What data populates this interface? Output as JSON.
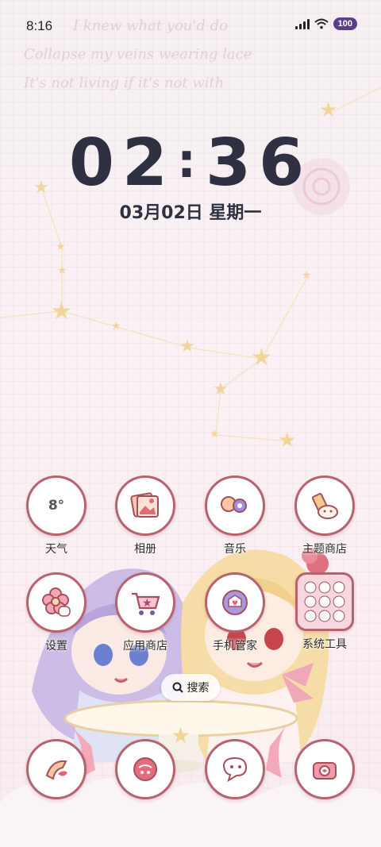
{
  "status_bar": {
    "time": "8:16",
    "battery": "100"
  },
  "background_text": {
    "line1": "I knew what you'd do",
    "line2": "Collapse my veins wearing lace",
    "line3": "It's not living if it's not with"
  },
  "lock_clock": {
    "hours": "02",
    "minutes": "36",
    "date": "03月02日 星期一"
  },
  "apps": [
    {
      "label": "天气",
      "icon": "weather-icon",
      "glyph": "8°"
    },
    {
      "label": "相册",
      "icon": "gallery-icon",
      "glyph": ""
    },
    {
      "label": "音乐",
      "icon": "music-icon",
      "glyph": ""
    },
    {
      "label": "主题商店",
      "icon": "theme-store-icon",
      "glyph": ""
    },
    {
      "label": "设置",
      "icon": "settings-icon",
      "glyph": ""
    },
    {
      "label": "应用商店",
      "icon": "app-store-icon",
      "glyph": ""
    },
    {
      "label": "手机管家",
      "icon": "phone-manager-icon",
      "glyph": ""
    },
    {
      "label": "系统工具",
      "icon": "system-tools-folder-icon",
      "glyph": ""
    }
  ],
  "search": {
    "label": "搜索"
  },
  "dock": [
    {
      "icon": "phone-icon"
    },
    {
      "icon": "messages-icon"
    },
    {
      "icon": "chat-icon"
    },
    {
      "icon": "camera-icon"
    }
  ],
  "colors": {
    "icon_ring": "#b5636f",
    "clock_text": "#2f3142",
    "battery_badge": "#5b3e8a",
    "star": "#f1d69c"
  }
}
